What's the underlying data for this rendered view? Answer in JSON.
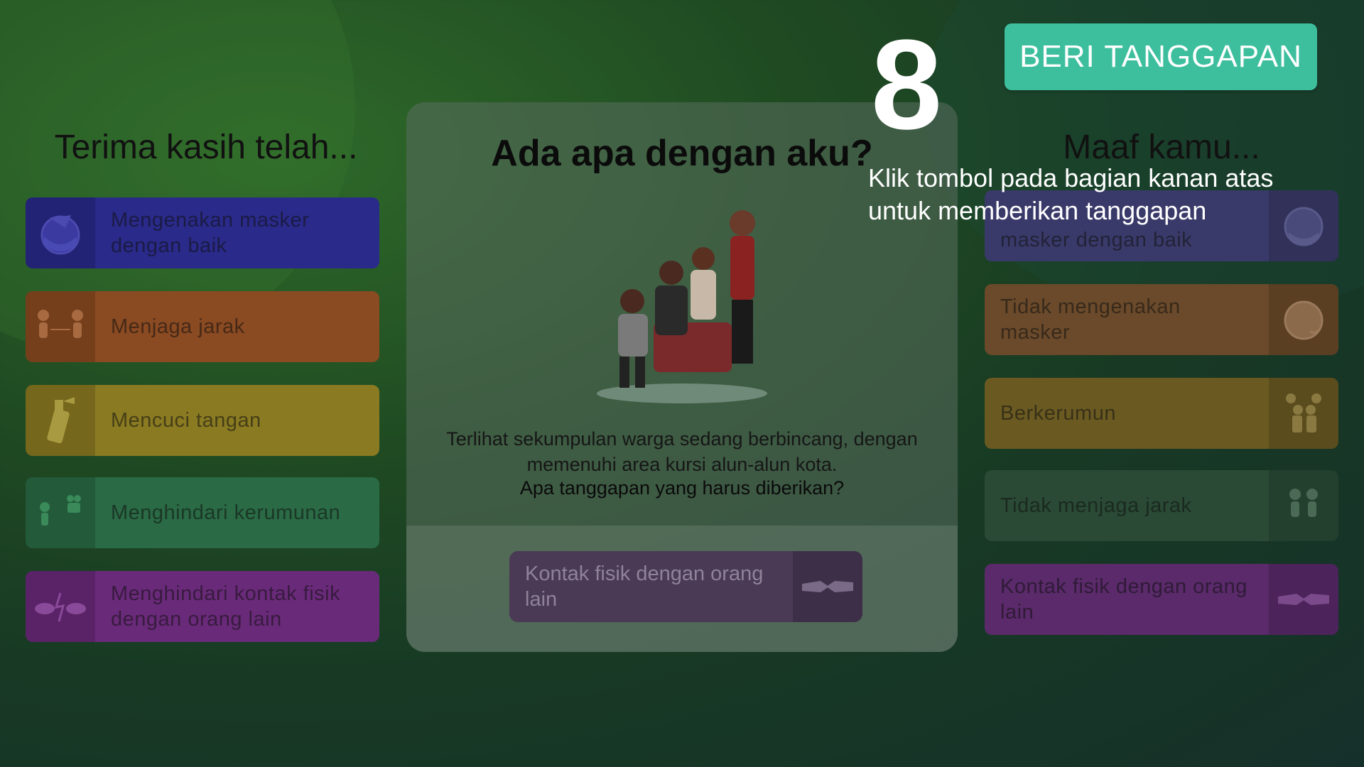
{
  "timer": "8",
  "respond_button": "BERI TANGGAPAN",
  "hint": "Klik tombol pada bagian kanan atas untuk memberikan tanggapan",
  "left_panel": {
    "title": "Terima kasih telah...",
    "cards": [
      {
        "label": "Mengenakan masker dengan baik",
        "icon": "mask-head-icon",
        "color": "#2a2a8a"
      },
      {
        "label": "Menjaga jarak",
        "icon": "distance-people-icon",
        "color": "#8a4a22"
      },
      {
        "label": "Mencuci tangan",
        "icon": "sanitizer-spray-icon",
        "color": "#8a7a22"
      },
      {
        "label": "Menghindari kerumunan",
        "icon": "avoid-crowd-icon",
        "color": "#2a6a45"
      },
      {
        "label": "Menghindari kontak fisik dengan orang lain",
        "icon": "avoid-contact-icon",
        "color": "#6a2a7a"
      }
    ]
  },
  "right_panel": {
    "title": "Maaf kamu...",
    "cards": [
      {
        "label": "masker dengan baik",
        "icon": "mask-head-icon",
        "color": "#3a3a6a"
      },
      {
        "label": "Tidak mengenakan masker",
        "icon": "no-mask-head-icon",
        "color": "#6a4a2a"
      },
      {
        "label": "Berkerumun",
        "icon": "crowd-icon",
        "color": "#6a5a22"
      },
      {
        "label": "Tidak menjaga jarak",
        "icon": "close-people-icon",
        "color": "#2a4a35"
      },
      {
        "label": "Kontak fisik dengan orang lain",
        "icon": "handshake-icon",
        "color": "#5a2a6a"
      }
    ]
  },
  "center": {
    "title": "Ada apa dengan aku?",
    "description": "Terlihat sekumpulan warga sedang berbincang, dengan memenuhi area kursi alun-alun kota.",
    "question": "Apa tanggapan yang harus diberikan?",
    "answer": {
      "label": "Kontak fisik dengan orang lain",
      "icon": "handshake-icon"
    }
  }
}
